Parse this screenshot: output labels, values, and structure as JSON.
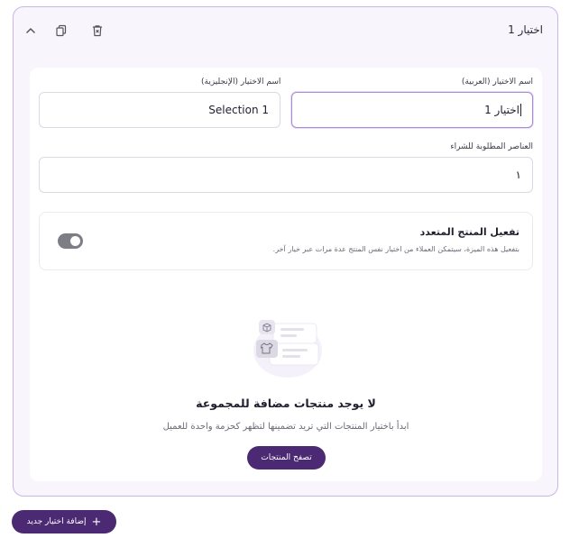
{
  "selection": {
    "title": "اختيار 1",
    "arabic_name": {
      "label": "اسم الاختيار (العربية)",
      "value": "اختيار 1"
    },
    "english_name": {
      "label": "اسم الاختيار (الإنجليزية)",
      "value": "Selection 1"
    },
    "required_items": {
      "label": "العناصر المطلوبة للشراء",
      "value": "١"
    },
    "multi_product": {
      "title": "تفعيل المنتج المتعدد",
      "description": "بتفعيل هذه الميزة، سيتمكن العملاء من اختيار نفس المنتج عدة مرات عبر خيار آخر.",
      "enabled": true
    },
    "empty_state": {
      "title": "لا يوجد منتجات مضافة للمجموعة",
      "description": "ابدأ باختيار المنتجات التي تريد تضمينها لتظهر كحزمة واحدة للعميل",
      "browse_label": "تصفح المنتجات"
    }
  },
  "add_selection_label": "إضافة اختيار جديد",
  "icons": {
    "collapse": "chevron-up-icon",
    "duplicate": "copy-icon",
    "delete": "trash-icon",
    "add": "plus-icon"
  },
  "colors": {
    "accent": "#4b2a73",
    "border": "#c9b5ea",
    "card_bg": "#f8f5fd"
  }
}
